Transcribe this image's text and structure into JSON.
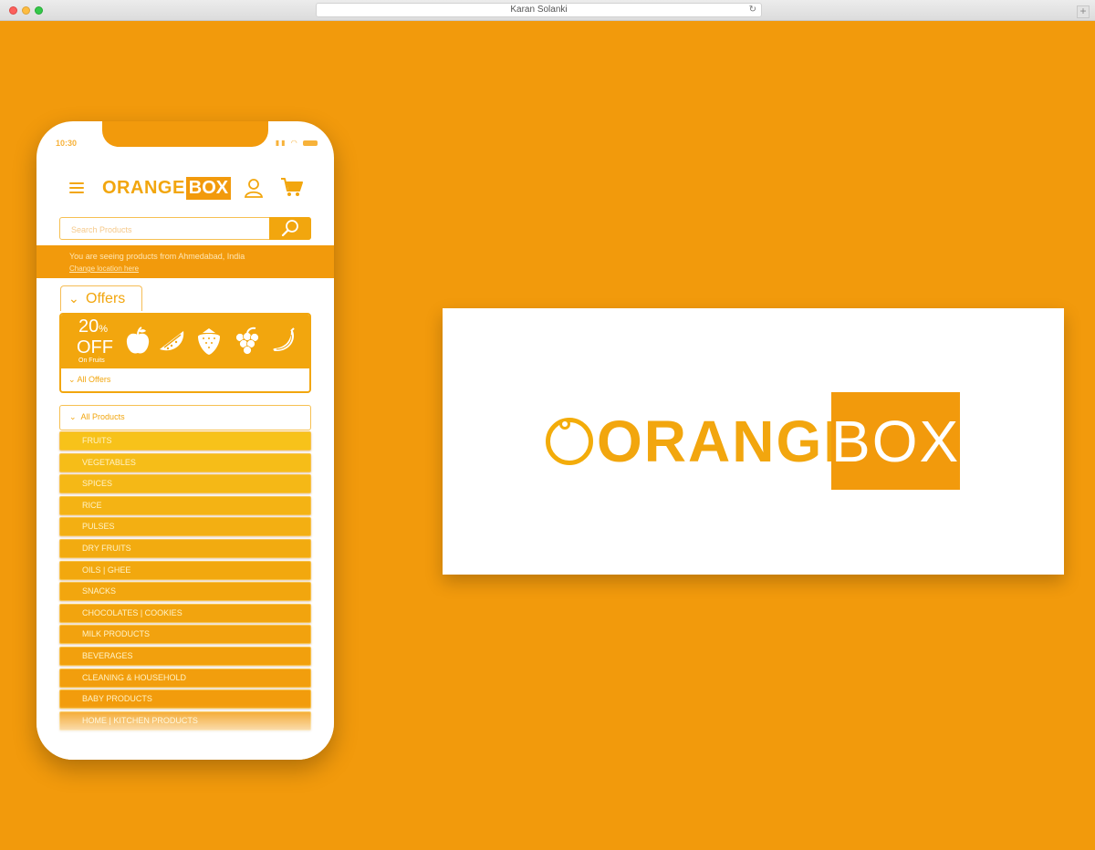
{
  "browser": {
    "url_title": "Karan Solanki",
    "reload_icon": "reload-icon",
    "new_tab_label": "+"
  },
  "phone": {
    "status_time": "10:30",
    "brand": {
      "word1": "ORANGE",
      "word2": "BOX"
    },
    "search": {
      "placeholder": "Search Products"
    },
    "location": {
      "line1": "You are seeing products from Ahmedabad, India",
      "line2": "Change location here"
    },
    "offers": {
      "tab_label": "Offers",
      "percent": "20",
      "percent_sign": "%",
      "off_label": "OFF",
      "sub_label": "On Fruits",
      "all_offers_label": "All Offers",
      "fruit_icons": [
        "apple-icon",
        "watermelon-icon",
        "strawberry-icon",
        "grapes-icon",
        "banana-icon"
      ]
    },
    "all_products_label": "All Products",
    "categories": [
      "FRUITS",
      "VEGETABLES",
      "SPICES",
      "RICE",
      "PULSES",
      "DRY FRUITS",
      "OILS | GHEE",
      "SNACKS",
      "CHOCOLATES | COOKIES",
      "MILK PRODUCTS",
      "BEVERAGES",
      "CLEANING & HOUSEHOLD",
      "BABY PRODUCTS",
      "HOME | KITCHEN PRODUCTS"
    ]
  },
  "logo_card": {
    "word1": "ORANGE",
    "word2": "BOX"
  },
  "colors": {
    "background": "#f29a0c",
    "accent": "#f2a60e",
    "white": "#ffffff"
  }
}
